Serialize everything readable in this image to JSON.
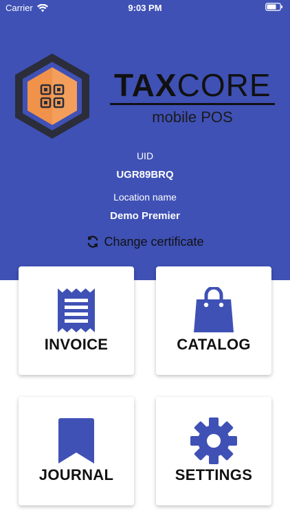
{
  "status": {
    "carrier": "Carrier",
    "time": "9:03 PM"
  },
  "brand": {
    "title_bold": "TAX",
    "title_rest": "CORE",
    "subtitle": "mobile POS"
  },
  "info": {
    "uid_label": "UID",
    "uid_value": "UGR89BRQ",
    "location_label": "Location name",
    "location_value": "Demo Premier"
  },
  "change_certificate": "Change certificate",
  "tiles": [
    {
      "label": "INVOICE",
      "icon": "receipt-icon"
    },
    {
      "label": "CATALOG",
      "icon": "shopping-bag-icon"
    },
    {
      "label": "JOURNAL",
      "icon": "bookmark-icon"
    },
    {
      "label": "SETTINGS",
      "icon": "gear-icon"
    }
  ],
  "colors": {
    "primary": "#3f51b5",
    "logo_orange": "#f0924a",
    "logo_dark": "#2b2d3a"
  }
}
